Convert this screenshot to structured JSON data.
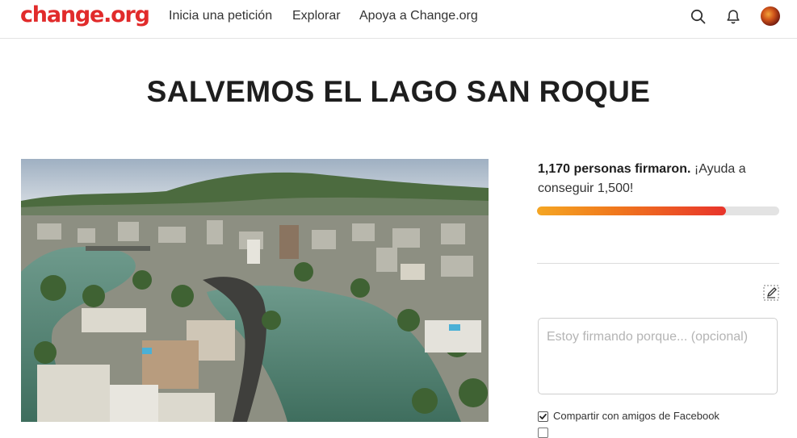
{
  "header": {
    "logo": "change.org",
    "nav": {
      "start_petition": "Inicia una petición",
      "explore": "Explorar",
      "support": "Apoya a Change.org"
    },
    "icons": [
      "search-icon",
      "bell-icon",
      "avatar"
    ]
  },
  "petition": {
    "title": "SALVEMOS EL LAGO SAN ROQUE",
    "photo_icon": "aerial-lake-city-photo"
  },
  "signatures": {
    "count_text": "1,170 personas firmaron.",
    "goal_text": " ¡Ayuda a conseguir 1,500!",
    "signed": 1170,
    "goal": 1500,
    "progress_fraction": 0.78
  },
  "form": {
    "reason_placeholder": "Estoy firmando porque... (opcional)",
    "share_facebook_label": "Compartir con amigos de Facebook",
    "share_facebook_checked": true
  },
  "colors": {
    "brand": "#e12b2b",
    "progress_start": "#f5a623",
    "progress_end": "#e8342b"
  }
}
